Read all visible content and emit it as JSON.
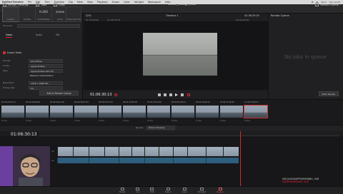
{
  "menubar": {
    "app": "DaVinci Resolve",
    "items": [
      "File",
      "Edit",
      "Trim",
      "Timeline",
      "Clip",
      "Mark",
      "View",
      "Playback",
      "Fusion",
      "Color",
      "Fairlight",
      "Workspace",
      "Help"
    ],
    "right": [
      "⌘",
      "◐",
      "Wi-Fi",
      "Sun 12:00"
    ]
  },
  "toolbar": {
    "render_settings": "Render Settings",
    "tape": "Tape",
    "clips": "Clips",
    "project_title": "block_footage_stuv",
    "render_queue": "Render Queue"
  },
  "render_settings": {
    "header": "Render Settings - Custom",
    "presets": [
      {
        "big": "",
        "name": "Custom"
      },
      {
        "big": "",
        "name": "YouTube"
      },
      {
        "big": "H.264",
        "name": "H.264 Master"
      },
      {
        "big": "vimeo",
        "name": "Vimeo"
      },
      {
        "big": "",
        "name": "ProRes 422 HQ"
      }
    ],
    "filename_label": "Filename",
    "tabs": [
      "Video",
      "Audio",
      "File"
    ],
    "export_video": "Export Video",
    "rows": [
      {
        "label": "Format",
        "value": "QuickTime"
      },
      {
        "label": "Codec",
        "value": "Apple ProRes"
      },
      {
        "label": "Type",
        "value": "Apple ProRes 422 HQ"
      },
      {
        "label": "",
        "value": "Network Optimization"
      },
      {
        "label": "Resolution",
        "value": "1920 x 1080 HD"
      },
      {
        "label": "Frame rate",
        "value": "24"
      }
    ],
    "add_to_queue": "Add to Render Queue"
  },
  "viewer": {
    "zoom": "22%",
    "timecode_left": "01:00:00:00",
    "timecode_mid": "01:06:30:13",
    "timeline_name": "Timeline 1",
    "timecode_right": "02:36:29:19",
    "duration": "00:00:00:00",
    "in_label": "In",
    "out_label": "Out"
  },
  "transport": {
    "timecode": "01:06:30:13",
    "buttons": [
      "first-frame-icon",
      "prev-icon",
      "stop-icon",
      "play-icon",
      "next-icon",
      "last-frame-icon",
      "loop-icon"
    ]
  },
  "render_queue": {
    "header": "Render Queue",
    "empty": "No jobs in queue",
    "start_render": "Start Render"
  },
  "clips": [
    {
      "label": "01  00:29:31:11",
      "cap": "ProRes"
    },
    {
      "label": "02  00:29:46:09",
      "cap": "ProRes"
    },
    {
      "label": "03  00:40:11:16",
      "cap": "ProRes"
    },
    {
      "label": "04  00:48:07:01",
      "cap": "ProRes"
    },
    {
      "label": "05  00:59:11:01",
      "cap": "ProRes"
    },
    {
      "label": "06  01:15:06:18",
      "cap": "ProRes"
    },
    {
      "label": "07  01:43:24:10",
      "cap": "ProRes"
    },
    {
      "label": "08  02:02:40:21",
      "cap": "ProRes"
    },
    {
      "label": "09  02:16:02:21",
      "cap": "ProRes"
    },
    {
      "label": "10  02:21:26:22",
      "cap": "ProRes"
    },
    {
      "label": "11  02:27:09:11",
      "cap": "ProRes"
    }
  ],
  "timeline": {
    "timecode": "01:06:30:13",
    "render_label": "Render",
    "render_value": "Entire Timeline",
    "track_v1": "V1",
    "track_a1": "A1"
  },
  "webcam_overlay": {
    "line1": "UBC/LIVE/HAPPY/MORNING, SUB",
    "line2": "SUMMER/MMXXIV, SUB"
  },
  "pages": [
    {
      "label": "Media",
      "active": false
    },
    {
      "label": "Cut",
      "active": false
    },
    {
      "label": "Edit",
      "active": false
    },
    {
      "label": "Fusion",
      "active": false
    },
    {
      "label": "Color",
      "active": false
    },
    {
      "label": "Fairlight",
      "active": false
    },
    {
      "label": "Deliver",
      "active": true
    }
  ],
  "colors": {
    "accent": "#d52b2b",
    "deliver_active": "#e05c5c",
    "audio_track": "#2e5f7d"
  }
}
